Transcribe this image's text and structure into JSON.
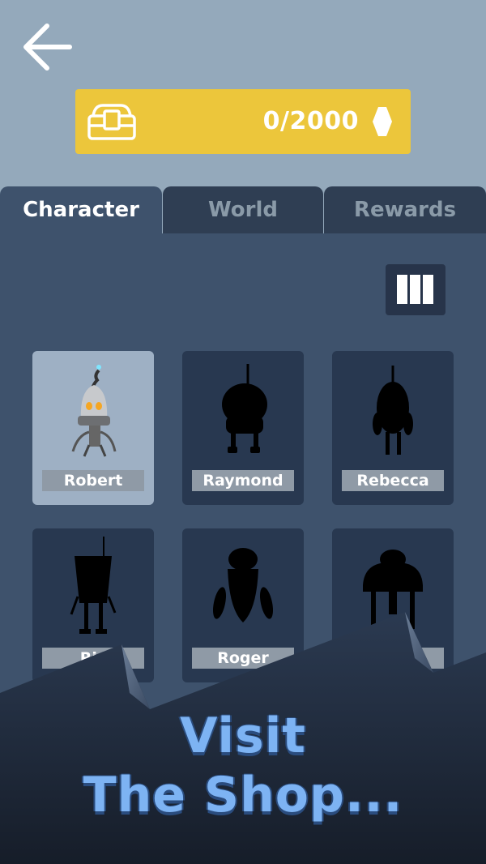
{
  "header": {
    "back_icon": "arrow-left-icon",
    "currency": {
      "icon": "treasure-chest-icon",
      "value": "0/2000",
      "gem_icon": "gem-icon"
    }
  },
  "tabs": [
    {
      "label": "Character",
      "active": true
    },
    {
      "label": "World",
      "active": false
    },
    {
      "label": "Rewards",
      "active": false
    }
  ],
  "view_toggle": {
    "icon": "grid-columns-icon"
  },
  "characters": [
    {
      "name": "Robert",
      "unlocked": true
    },
    {
      "name": "Raymond",
      "unlocked": false
    },
    {
      "name": "Rebecca",
      "unlocked": false
    },
    {
      "name": "Ric",
      "unlocked": false
    },
    {
      "name": "Roger",
      "unlocked": false
    },
    {
      "name": "l",
      "unlocked": false
    }
  ],
  "promo": {
    "line1": "Visit",
    "line2": "The Shop..."
  },
  "colors": {
    "accent": "#ecc63b",
    "panel": "#3e526c",
    "card": "#283850",
    "promo_text": "#7db3f3"
  }
}
